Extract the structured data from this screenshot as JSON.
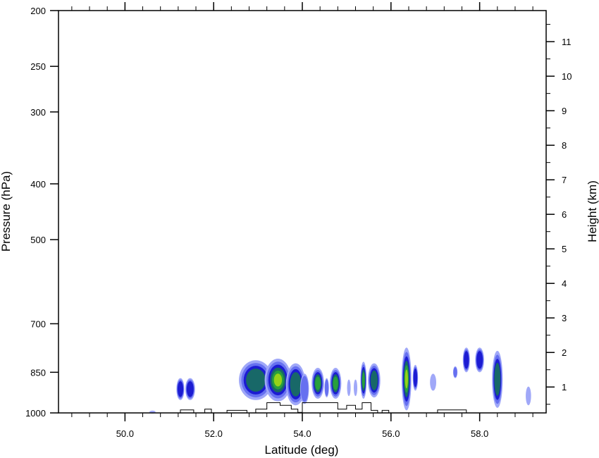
{
  "chart_data": {
    "type": "heatmap",
    "xlabel": "Latitude (deg)",
    "ylabel_left": "Pressure (hPa)",
    "ylabel_right": "Height (km)",
    "x_range": [
      48.5,
      59.5
    ],
    "x_ticks": [
      50.0,
      52.0,
      54.0,
      56.0,
      58.0
    ],
    "x_tick_labels": [
      "50.0",
      "52.0",
      "54.0",
      "56.0",
      "58.0"
    ],
    "x_minor_step": 0.4,
    "y_left_range_hpa": [
      1000,
      200
    ],
    "y_left_scale": "log",
    "y_left_ticks": [
      1000,
      850,
      700,
      500,
      400,
      300,
      250,
      200
    ],
    "y_left_tick_labels": [
      "1000",
      "850",
      "700",
      "500",
      "400",
      "300",
      "250",
      "200"
    ],
    "y_right_ticks_km": [
      1,
      2,
      3,
      4,
      5,
      6,
      7,
      8,
      9,
      10,
      11
    ],
    "y_right_tick_labels": [
      "1",
      "2",
      "3",
      "4",
      "5",
      "6",
      "7",
      "8",
      "9",
      "10",
      "11"
    ],
    "level_colors": [
      "#a0a8f8",
      "#6670f0",
      "#1c1cd2",
      "#186868",
      "#28a03c",
      "#96d219"
    ],
    "cells": [
      {
        "lat": 50.62,
        "p": 997,
        "hw": 0.07,
        "hh": 4,
        "level": 0
      },
      {
        "lat": 51.25,
        "p": 910,
        "hw": 0.09,
        "hh": 40,
        "level": 2
      },
      {
        "lat": 51.47,
        "p": 910,
        "hw": 0.11,
        "hh": 40,
        "level": 2
      },
      {
        "lat": 52.95,
        "p": 880,
        "hw": 0.38,
        "hh": 70,
        "level": 3
      },
      {
        "lat": 53.45,
        "p": 880,
        "hw": 0.3,
        "hh": 75,
        "level": 5
      },
      {
        "lat": 53.85,
        "p": 895,
        "hw": 0.22,
        "hh": 75,
        "level": 3
      },
      {
        "lat": 54.05,
        "p": 910,
        "hw": 0.1,
        "hh": 55,
        "level": 1
      },
      {
        "lat": 54.35,
        "p": 890,
        "hw": 0.14,
        "hh": 55,
        "level": 4
      },
      {
        "lat": 54.55,
        "p": 905,
        "hw": 0.05,
        "hh": 35,
        "level": 1
      },
      {
        "lat": 54.75,
        "p": 890,
        "hw": 0.13,
        "hh": 55,
        "level": 4
      },
      {
        "lat": 55.05,
        "p": 905,
        "hw": 0.04,
        "hh": 30,
        "level": 0
      },
      {
        "lat": 55.2,
        "p": 905,
        "hw": 0.04,
        "hh": 30,
        "level": 0
      },
      {
        "lat": 55.38,
        "p": 880,
        "hw": 0.07,
        "hh": 65,
        "level": 4
      },
      {
        "lat": 55.62,
        "p": 880,
        "hw": 0.14,
        "hh": 60,
        "level": 3
      },
      {
        "lat": 56.35,
        "p": 880,
        "hw": 0.11,
        "hh": 110,
        "level": 5
      },
      {
        "lat": 56.55,
        "p": 870,
        "hw": 0.06,
        "hh": 45,
        "level": 2
      },
      {
        "lat": 56.95,
        "p": 885,
        "hw": 0.07,
        "hh": 30,
        "level": 0
      },
      {
        "lat": 57.45,
        "p": 850,
        "hw": 0.05,
        "hh": 20,
        "level": 1
      },
      {
        "lat": 57.7,
        "p": 810,
        "hw": 0.08,
        "hh": 40,
        "level": 2
      },
      {
        "lat": 58.0,
        "p": 810,
        "hw": 0.1,
        "hh": 40,
        "level": 2
      },
      {
        "lat": 58.4,
        "p": 880,
        "hw": 0.12,
        "hh": 100,
        "level": 3
      },
      {
        "lat": 59.1,
        "p": 935,
        "hw": 0.06,
        "hh": 35,
        "level": 0
      }
    ],
    "terrain_outline": [
      [
        51.25,
        1000
      ],
      [
        51.25,
        988
      ],
      [
        51.55,
        988
      ],
      [
        51.55,
        1000
      ],
      [
        51.8,
        1000
      ],
      [
        51.8,
        985
      ],
      [
        51.95,
        985
      ],
      [
        51.95,
        1000
      ],
      [
        52.3,
        1000
      ],
      [
        52.3,
        990
      ],
      [
        52.75,
        990
      ],
      [
        52.75,
        1000
      ],
      [
        52.95,
        1000
      ],
      [
        52.95,
        985
      ],
      [
        53.2,
        985
      ],
      [
        53.2,
        960
      ],
      [
        53.5,
        960
      ],
      [
        53.5,
        970
      ],
      [
        53.75,
        970
      ],
      [
        53.75,
        985
      ],
      [
        53.9,
        985
      ],
      [
        53.9,
        998
      ],
      [
        54.0,
        998
      ],
      [
        54.0,
        960
      ],
      [
        54.8,
        960
      ],
      [
        54.8,
        985
      ],
      [
        55.0,
        985
      ],
      [
        55.0,
        970
      ],
      [
        55.2,
        970
      ],
      [
        55.2,
        985
      ],
      [
        55.35,
        985
      ],
      [
        55.35,
        960
      ],
      [
        55.55,
        960
      ],
      [
        55.55,
        990
      ],
      [
        55.7,
        990
      ],
      [
        55.7,
        1000
      ],
      [
        55.8,
        1000
      ],
      [
        55.8,
        990
      ],
      [
        55.95,
        990
      ],
      [
        55.95,
        1000
      ],
      [
        57.05,
        1000
      ],
      [
        57.05,
        988
      ],
      [
        57.7,
        988
      ],
      [
        57.7,
        1000
      ]
    ]
  }
}
